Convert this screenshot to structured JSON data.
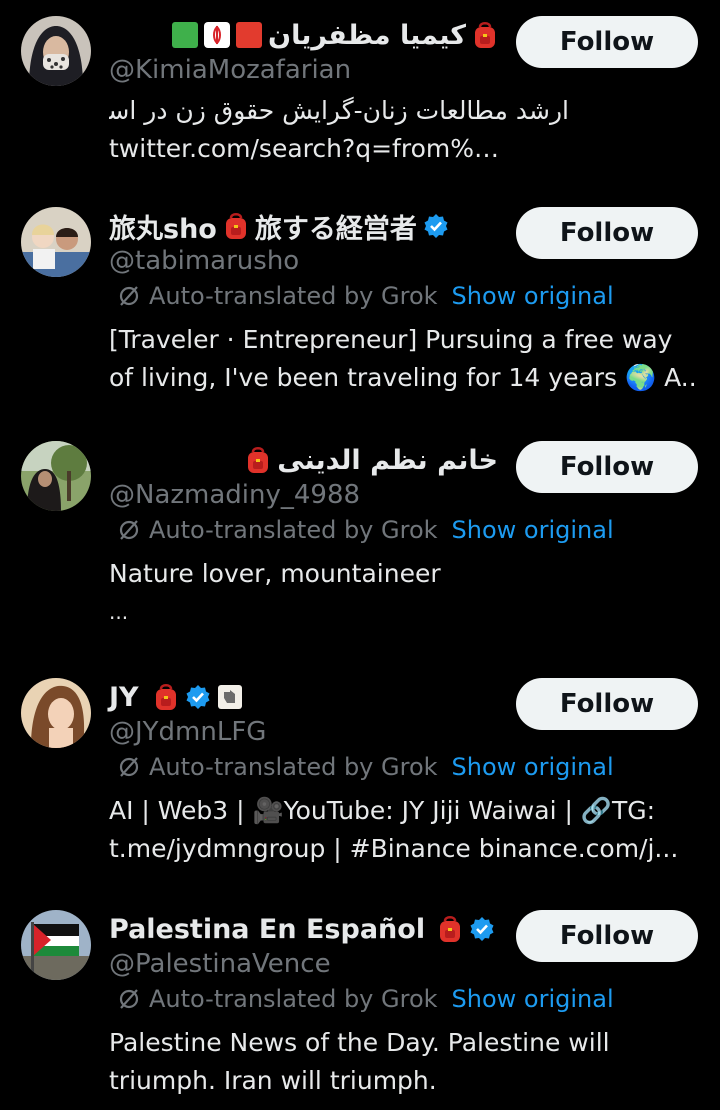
{
  "colors": {
    "background": "#000000",
    "text": "#e7e9ea",
    "muted": "#71767b",
    "link": "#1d9bf0",
    "verified": "#1d9bf0",
    "button_bg": "#eff3f4",
    "button_text": "#0f1419"
  },
  "follow_label": "Follow",
  "translate": {
    "auto_label": "Auto-translated by Grok",
    "show_original": "Show original"
  },
  "users": [
    {
      "display_name": "کیمیا مظفریان",
      "name_extras": [
        "green-square-icon",
        "iran-emblem-icon",
        "red-square-icon",
        "backpack-icon"
      ],
      "handle": "@KimiaMozafarian",
      "bio_line1": "ارشد مطالعات زنان-گرایش حقوق زن در اسلام",
      "bio_line2": "twitter.com/search?q=from%…"
    },
    {
      "display_name_a": "旅丸sho",
      "display_name_b": "旅する経営者",
      "name_extras": [
        "backpack-icon",
        "verified-badge-icon"
      ],
      "handle": "@tabimarusho",
      "bio_line1": "[Traveler · Entrepreneur] Pursuing a free way",
      "bio_line2": "of living, I've been traveling for 14 years 🌍 A..."
    },
    {
      "display_name": "خانم نظم الدینی",
      "name_extras": [
        "backpack-icon"
      ],
      "handle": "@Nazmadiny_4988",
      "bio_line1": "Nature lover, mountaineer",
      "bio_line2": "..."
    },
    {
      "display_name": "JY",
      "name_extras": [
        "backpack-icon",
        "verified-badge-icon",
        "hand-icon"
      ],
      "handle": "@JYdmnLFG",
      "bio_line1": "AI | Web3 | 🎥YouTube: JY Jiji Waiwai | 🔗TG:",
      "bio_line2": "t.me/jydmngroup | #Binance binance.com/j..."
    },
    {
      "display_name": "Palestina En Español",
      "name_extras": [
        "backpack-icon",
        "verified-badge-icon"
      ],
      "handle": "@PalestinaVence",
      "bio_line1": "Palestine News of the Day. Palestine will",
      "bio_line2": "triumph. Iran will triumph."
    }
  ]
}
